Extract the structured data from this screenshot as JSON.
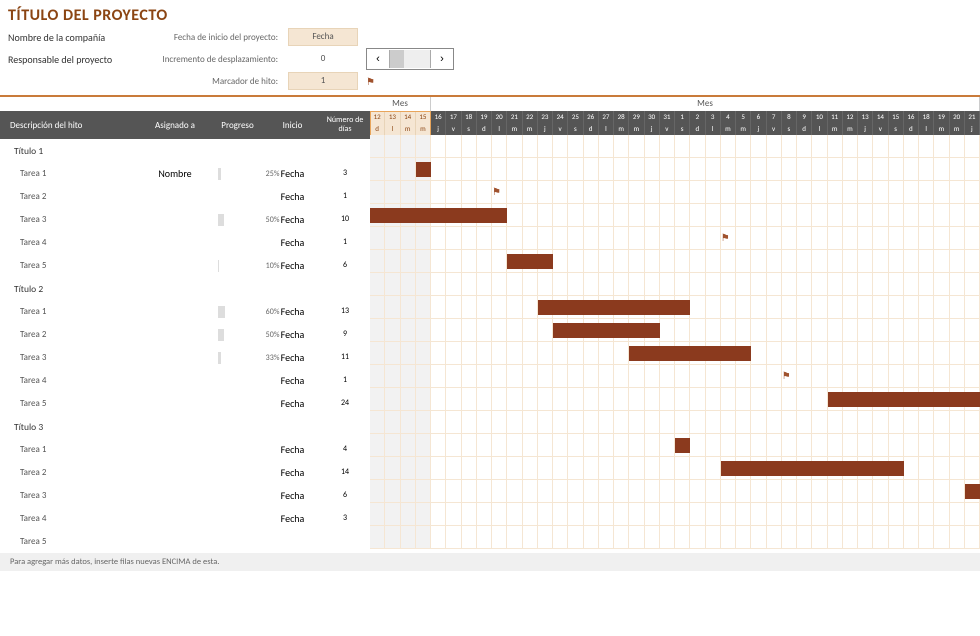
{
  "title": "TÍTULO DEL PROYECTO",
  "company_label": "Nombre de la compañía",
  "owner_label": "Responsable del proyecto",
  "meta": {
    "start_date_label": "Fecha de inicio del proyecto:",
    "start_date_value": "Fecha",
    "scroll_label": "Incremento de desplazamiento:",
    "scroll_value": "0",
    "milestone_label": "Marcador de hito:",
    "milestone_value": "1"
  },
  "columns": {
    "desc": "Descripción del hito",
    "assigned": "Asignado a",
    "progress": "Progreso",
    "start": "Inicio",
    "days": "Número de días"
  },
  "month_labels": [
    "Mes",
    "Mes"
  ],
  "timeline": {
    "light_days": 4,
    "days": [
      {
        "n": "12",
        "w": "d"
      },
      {
        "n": "13",
        "w": "l"
      },
      {
        "n": "14",
        "w": "m"
      },
      {
        "n": "15",
        "w": "m"
      },
      {
        "n": "16",
        "w": "j"
      },
      {
        "n": "17",
        "w": "v"
      },
      {
        "n": "18",
        "w": "s"
      },
      {
        "n": "19",
        "w": "d"
      },
      {
        "n": "20",
        "w": "l"
      },
      {
        "n": "21",
        "w": "m"
      },
      {
        "n": "22",
        "w": "m"
      },
      {
        "n": "23",
        "w": "j"
      },
      {
        "n": "24",
        "w": "v"
      },
      {
        "n": "25",
        "w": "s"
      },
      {
        "n": "26",
        "w": "d"
      },
      {
        "n": "27",
        "w": "l"
      },
      {
        "n": "28",
        "w": "m"
      },
      {
        "n": "29",
        "w": "m"
      },
      {
        "n": "30",
        "w": "j"
      },
      {
        "n": "31",
        "w": "v"
      },
      {
        "n": "1",
        "w": "s"
      },
      {
        "n": "2",
        "w": "d"
      },
      {
        "n": "3",
        "w": "l"
      },
      {
        "n": "4",
        "w": "m"
      },
      {
        "n": "5",
        "w": "m"
      },
      {
        "n": "6",
        "w": "j"
      },
      {
        "n": "7",
        "w": "v"
      },
      {
        "n": "8",
        "w": "s"
      },
      {
        "n": "9",
        "w": "d"
      },
      {
        "n": "10",
        "w": "l"
      },
      {
        "n": "11",
        "w": "m"
      },
      {
        "n": "12",
        "w": "m"
      },
      {
        "n": "13",
        "w": "j"
      },
      {
        "n": "14",
        "w": "v"
      },
      {
        "n": "15",
        "w": "s"
      },
      {
        "n": "16",
        "w": "d"
      },
      {
        "n": "18",
        "w": "l"
      },
      {
        "n": "19",
        "w": "m"
      },
      {
        "n": "20",
        "w": "m"
      },
      {
        "n": "21",
        "w": "j"
      }
    ]
  },
  "tasks": [
    {
      "type": "section",
      "desc": "Título 1"
    },
    {
      "type": "task",
      "desc": "Tarea 1",
      "assigned": "Nombre",
      "progress": 25,
      "start": "Fecha",
      "days": "3",
      "bar_start": 3,
      "bar_len": 1
    },
    {
      "type": "task",
      "desc": "Tarea 2",
      "assigned": "",
      "progress": null,
      "start": "Fecha",
      "days": "1",
      "flag_at": 8
    },
    {
      "type": "task",
      "desc": "Tarea 3",
      "assigned": "",
      "progress": 50,
      "start": "Fecha",
      "days": "10",
      "bar_start": 0,
      "bar_len": 9
    },
    {
      "type": "task",
      "desc": "Tarea 4",
      "assigned": "",
      "progress": null,
      "start": "Fecha",
      "days": "1",
      "flag_at": 23
    },
    {
      "type": "task",
      "desc": "Tarea 5",
      "assigned": "",
      "progress": 10,
      "start": "Fecha",
      "days": "6",
      "bar_start": 9,
      "bar_len": 3
    },
    {
      "type": "section",
      "desc": "Título 2"
    },
    {
      "type": "task",
      "desc": "Tarea 1",
      "assigned": "",
      "progress": 60,
      "start": "Fecha",
      "days": "13",
      "bar_start": 11,
      "bar_len": 10
    },
    {
      "type": "task",
      "desc": "Tarea 2",
      "assigned": "",
      "progress": 50,
      "start": "Fecha",
      "days": "9",
      "bar_start": 12,
      "bar_len": 7
    },
    {
      "type": "task",
      "desc": "Tarea 3",
      "assigned": "",
      "progress": 33,
      "start": "Fecha",
      "days": "11",
      "bar_start": 17,
      "bar_len": 8
    },
    {
      "type": "task",
      "desc": "Tarea 4",
      "assigned": "",
      "progress": null,
      "start": "Fecha",
      "days": "1",
      "flag_at": 27
    },
    {
      "type": "task",
      "desc": "Tarea 5",
      "assigned": "",
      "progress": null,
      "start": "Fecha",
      "days": "24",
      "bar_start": 30,
      "bar_len": 10
    },
    {
      "type": "section",
      "desc": "Título 3"
    },
    {
      "type": "task",
      "desc": "Tarea 1",
      "assigned": "",
      "progress": null,
      "start": "Fecha",
      "days": "4",
      "bar_start": 20,
      "bar_len": 1
    },
    {
      "type": "task",
      "desc": "Tarea 2",
      "assigned": "",
      "progress": null,
      "start": "Fecha",
      "days": "14",
      "bar_start": 23,
      "bar_len": 12
    },
    {
      "type": "task",
      "desc": "Tarea 3",
      "assigned": "",
      "progress": null,
      "start": "Fecha",
      "days": "6",
      "bar_start": 39,
      "bar_len": 1
    },
    {
      "type": "task",
      "desc": "Tarea 4",
      "assigned": "",
      "progress": null,
      "start": "Fecha",
      "days": "3"
    },
    {
      "type": "task",
      "desc": "Tarea 5",
      "assigned": "",
      "progress": null,
      "start": "",
      "days": ""
    }
  ],
  "footer": "Para agregar más datos, inserte filas nuevas ENCIMA de esta.",
  "chart_data": {
    "type": "gantt",
    "title": "TÍTULO DEL PROYECTO",
    "x_unit": "day",
    "x_start_index": 12,
    "x_visible_days": 40,
    "series": [
      {
        "group": "Título 1",
        "name": "Tarea 1",
        "progress_pct": 25,
        "duration_days": 3,
        "start_offset": 3,
        "length": 1
      },
      {
        "group": "Título 1",
        "name": "Tarea 2",
        "progress_pct": null,
        "duration_days": 1,
        "milestone_offset": 8
      },
      {
        "group": "Título 1",
        "name": "Tarea 3",
        "progress_pct": 50,
        "duration_days": 10,
        "start_offset": 0,
        "length": 9
      },
      {
        "group": "Título 1",
        "name": "Tarea 4",
        "progress_pct": null,
        "duration_days": 1,
        "milestone_offset": 23
      },
      {
        "group": "Título 1",
        "name": "Tarea 5",
        "progress_pct": 10,
        "duration_days": 6,
        "start_offset": 9,
        "length": 3
      },
      {
        "group": "Título 2",
        "name": "Tarea 1",
        "progress_pct": 60,
        "duration_days": 13,
        "start_offset": 11,
        "length": 10
      },
      {
        "group": "Título 2",
        "name": "Tarea 2",
        "progress_pct": 50,
        "duration_days": 9,
        "start_offset": 12,
        "length": 7
      },
      {
        "group": "Título 2",
        "name": "Tarea 3",
        "progress_pct": 33,
        "duration_days": 11,
        "start_offset": 17,
        "length": 8
      },
      {
        "group": "Título 2",
        "name": "Tarea 4",
        "progress_pct": null,
        "duration_days": 1,
        "milestone_offset": 27
      },
      {
        "group": "Título 2",
        "name": "Tarea 5",
        "progress_pct": null,
        "duration_days": 24,
        "start_offset": 30,
        "length": 10
      },
      {
        "group": "Título 3",
        "name": "Tarea 1",
        "progress_pct": null,
        "duration_days": 4,
        "start_offset": 20,
        "length": 1
      },
      {
        "group": "Título 3",
        "name": "Tarea 2",
        "progress_pct": null,
        "duration_days": 14,
        "start_offset": 23,
        "length": 12
      },
      {
        "group": "Título 3",
        "name": "Tarea 3",
        "progress_pct": null,
        "duration_days": 6,
        "start_offset": 39,
        "length": 1
      },
      {
        "group": "Título 3",
        "name": "Tarea 4",
        "progress_pct": null,
        "duration_days": 3
      },
      {
        "group": "Título 3",
        "name": "Tarea 5",
        "progress_pct": null,
        "duration_days": null
      }
    ]
  }
}
